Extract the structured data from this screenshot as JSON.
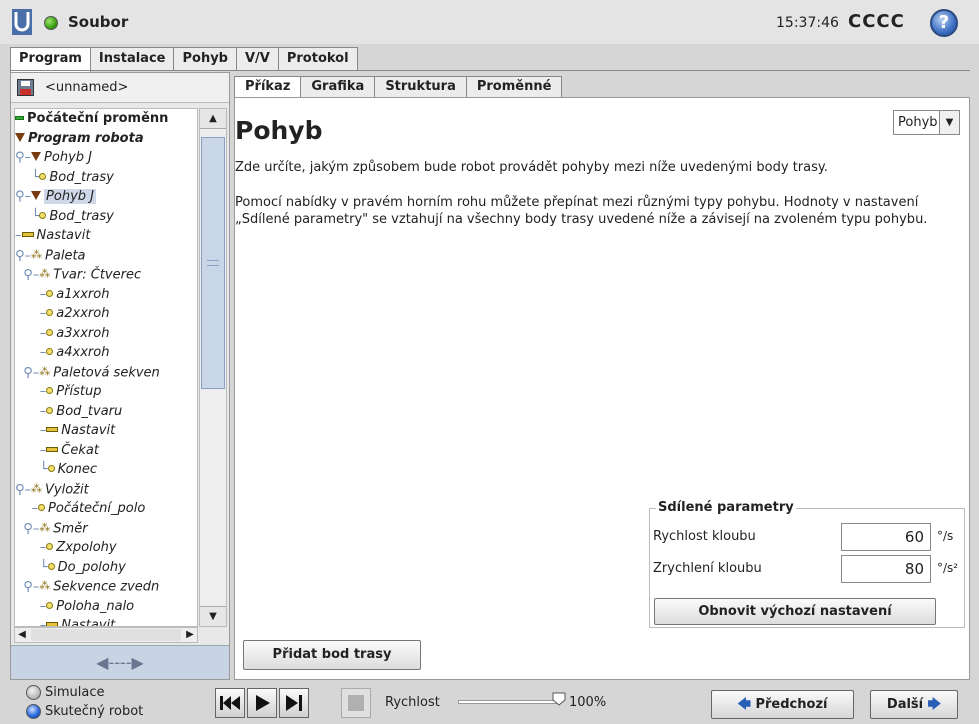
{
  "header": {
    "app_title": "Soubor",
    "clock": "15:37:46",
    "robot_name": "CCCC",
    "help_label": "?"
  },
  "main_tabs": [
    {
      "label": "Program",
      "active": true
    },
    {
      "label": "Instalace",
      "active": false
    },
    {
      "label": "Pohyb",
      "active": false
    },
    {
      "label": "V/V",
      "active": false
    },
    {
      "label": "Protokol",
      "active": false
    }
  ],
  "file": {
    "name": "<unnamed>"
  },
  "tree": [
    {
      "label": "Počáteční proměnn",
      "icon": "variables-icon",
      "prefix": "",
      "style": "bold"
    },
    {
      "label": "Program robota",
      "icon": "program-icon",
      "prefix": "",
      "style": "bolditalic"
    },
    {
      "label": "Pohyb J",
      "icon": "move-icon",
      "prefix": "⚲–",
      "style": "italic"
    },
    {
      "label": "Bod_trasy",
      "icon": "waypoint-icon",
      "prefix": "    └",
      "style": "italic"
    },
    {
      "label": "Pohyb J",
      "icon": "move-icon",
      "prefix": "⚲–",
      "style": "italic",
      "selected": true
    },
    {
      "label": "Bod_trasy",
      "icon": "waypoint-icon",
      "prefix": "    └",
      "style": "italic"
    },
    {
      "label": "Nastavit",
      "icon": "set-icon",
      "prefix": "–",
      "style": "italic"
    },
    {
      "label": "Paleta",
      "icon": "pallet-icon",
      "prefix": "⚲–",
      "style": "italic"
    },
    {
      "label": "Tvar: Čtverec",
      "icon": "pallet-icon",
      "prefix": "  ⚲–",
      "style": "italic"
    },
    {
      "label": "a1xxroh",
      "icon": "waypoint-icon",
      "prefix": "      –",
      "style": "italic"
    },
    {
      "label": "a2xxroh",
      "icon": "waypoint-icon",
      "prefix": "      –",
      "style": "italic"
    },
    {
      "label": "a3xxroh",
      "icon": "waypoint-icon",
      "prefix": "      –",
      "style": "italic"
    },
    {
      "label": "a4xxroh",
      "icon": "waypoint-icon",
      "prefix": "      –",
      "style": "italic"
    },
    {
      "label": "Paletová sekven",
      "icon": "pallet-icon",
      "prefix": "  ⚲–",
      "style": "italic"
    },
    {
      "label": "Přístup",
      "icon": "waypoint-icon",
      "prefix": "      –",
      "style": "italic"
    },
    {
      "label": "Bod_tvaru",
      "icon": "waypoint-icon",
      "prefix": "      –",
      "style": "italic"
    },
    {
      "label": "Nastavit",
      "icon": "set-icon",
      "prefix": "      –",
      "style": "italic"
    },
    {
      "label": "Čekat",
      "icon": "set-icon",
      "prefix": "      –",
      "style": "italic"
    },
    {
      "label": "Konec",
      "icon": "waypoint-icon",
      "prefix": "      └",
      "style": "italic"
    },
    {
      "label": "Vyložit",
      "icon": "pallet-icon",
      "prefix": "⚲–",
      "style": "italic"
    },
    {
      "label": "Počáteční_polo",
      "icon": "waypoint-icon",
      "prefix": "    –",
      "style": "italic"
    },
    {
      "label": "Směr",
      "icon": "pallet-icon",
      "prefix": "  ⚲–",
      "style": "italic"
    },
    {
      "label": "Zxpolohy",
      "icon": "waypoint-icon",
      "prefix": "      –",
      "style": "italic"
    },
    {
      "label": "Do_polohy",
      "icon": "waypoint-icon",
      "prefix": "      └",
      "style": "italic"
    },
    {
      "label": "Sekvence zvedn",
      "icon": "pallet-icon",
      "prefix": "  ⚲–",
      "style": "italic"
    },
    {
      "label": "Poloha_nalo",
      "icon": "waypoint-icon",
      "prefix": "      –",
      "style": "italic"
    },
    {
      "label": "Nastavit",
      "icon": "set-icon",
      "prefix": "      –",
      "style": "italic"
    }
  ],
  "sub_tabs": [
    {
      "label": "Příkaz",
      "active": true
    },
    {
      "label": "Grafika",
      "active": false
    },
    {
      "label": "Struktura",
      "active": false
    },
    {
      "label": "Proměnné",
      "active": false
    }
  ],
  "command": {
    "title": "Pohyb",
    "move_type": "Pohyb J",
    "description_1": "Zde určíte, jakým způsobem bude robot provádět pohyby mezi níže uvedenými body trasy.",
    "description_2": "Pomocí nabídky v pravém horním rohu můžete přepínat mezi různými typy pohybu. Hodnoty v nastavení „Sdílené parametry\" se vztahují na všechny body trasy uvedené níže a závisejí na zvoleném typu pohybu.",
    "shared_params": {
      "title": "Sdílené parametry",
      "joint_speed_label": "Rychlost kloubu",
      "joint_speed_value": "60",
      "joint_speed_unit": "°/s",
      "joint_accel_label": "Zrychlení kloubu",
      "joint_accel_value": "80",
      "joint_accel_unit": "°/s²",
      "reset_label": "Obnovit výchozí nastavení"
    },
    "add_waypoint_label": "Přidat bod trasy"
  },
  "footer": {
    "simulation_label": "Simulace",
    "real_robot_label": "Skutečný robot",
    "speed_label": "Rychlost",
    "speed_value": "100%",
    "speed_fraction": 1.0,
    "previous_label": "Předchozí",
    "next_label": "Další"
  },
  "colors": {
    "background": "#d6d6d6",
    "selection": "#cfd8e8",
    "scroll_thumb": "#c9d6e8"
  }
}
